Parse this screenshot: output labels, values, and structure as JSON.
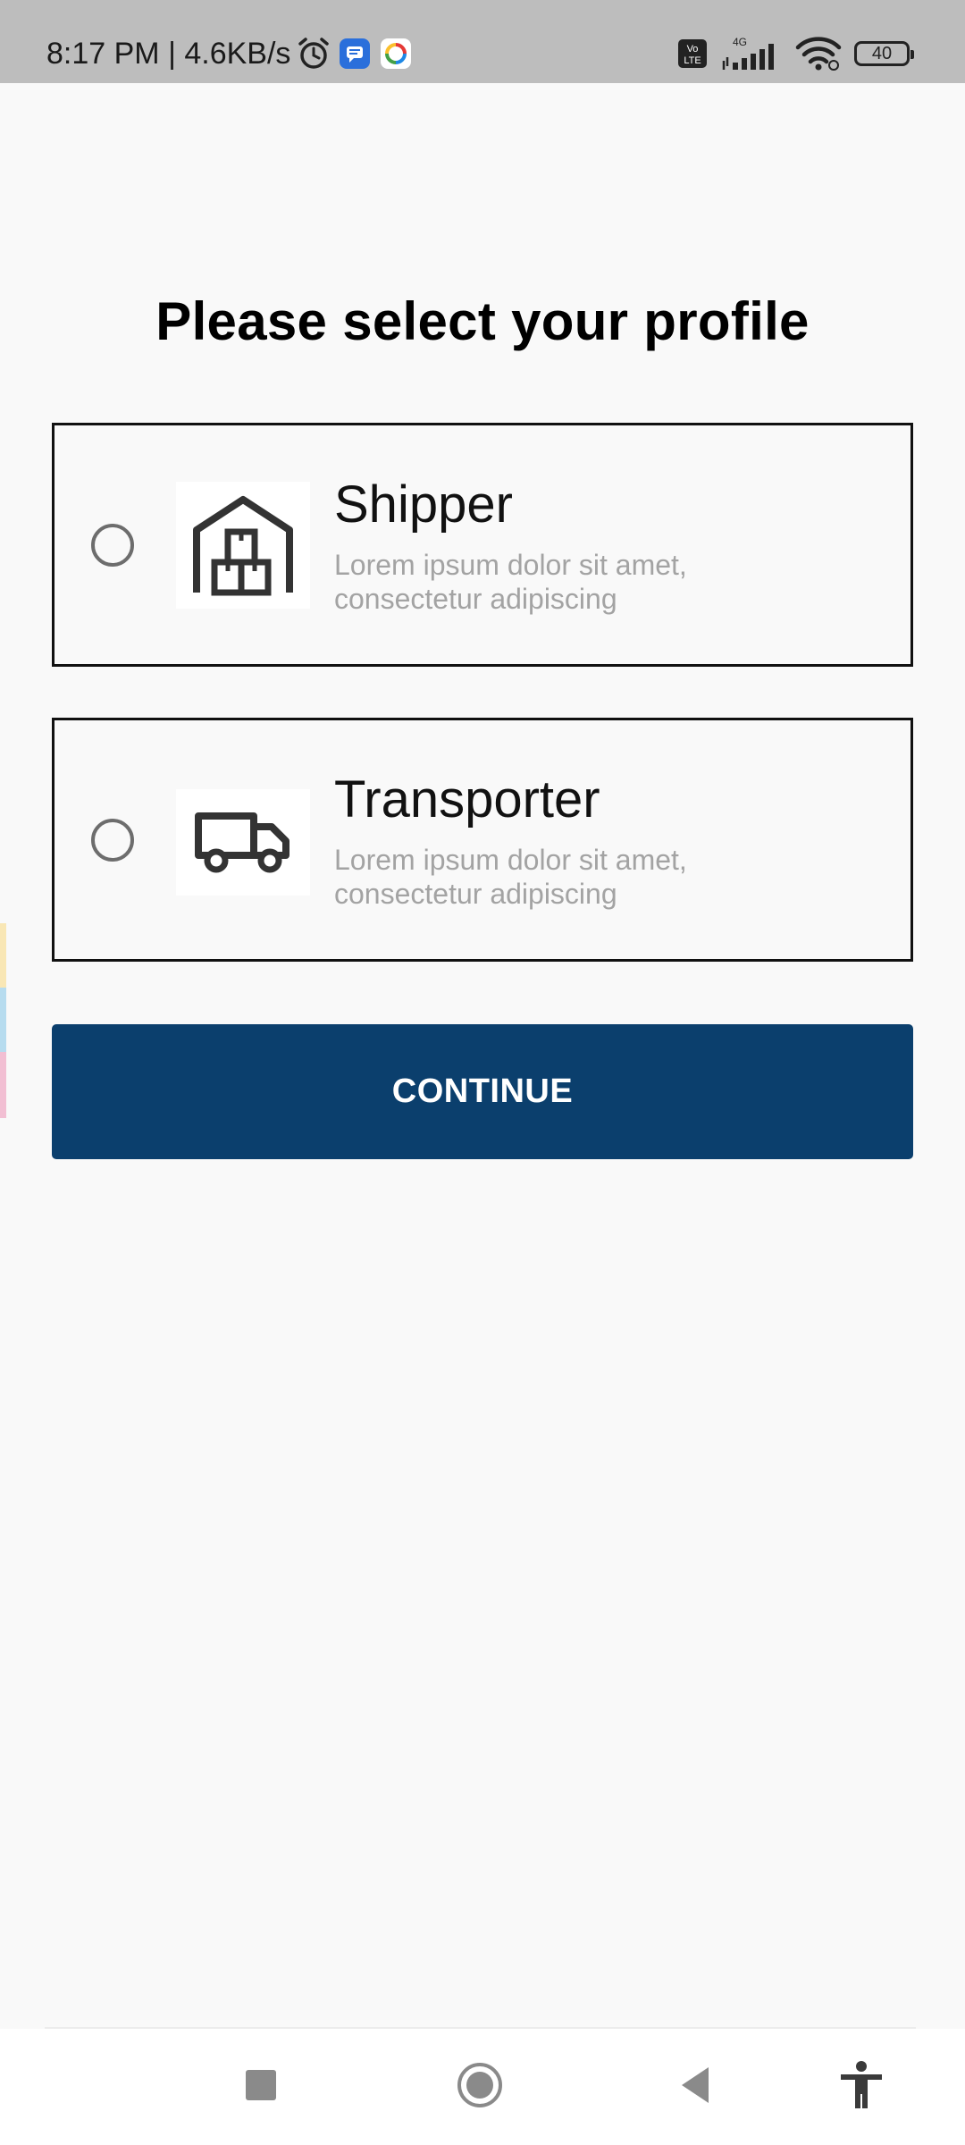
{
  "status_bar": {
    "time_text": "8:17 PM | 4.6KB/s",
    "network_label": "4G",
    "volte_label": "Vo LTE",
    "battery_level": "40"
  },
  "page": {
    "title": "Please select your profile"
  },
  "profiles": [
    {
      "title": "Shipper",
      "description": "Lorem ipsum dolor sit amet, consectetur adipiscing",
      "icon": "warehouse-icon",
      "selected": false
    },
    {
      "title": "Transporter",
      "description": "Lorem ipsum dolor sit amet, consectetur adipiscing",
      "icon": "truck-icon",
      "selected": false
    }
  ],
  "actions": {
    "continue_label": "CONTINUE"
  },
  "navigation": {
    "buttons": [
      "recents-icon",
      "home-icon",
      "back-icon",
      "accessibility-icon"
    ]
  },
  "colors": {
    "primary_button": "#0b3f6d",
    "background": "#f9f9f9",
    "status_bar": "#bdbdbd",
    "description_text": "#a3a3a3",
    "edge_strips": [
      "#f9e7b5",
      "#b7dcef",
      "#f2bfd3"
    ]
  }
}
